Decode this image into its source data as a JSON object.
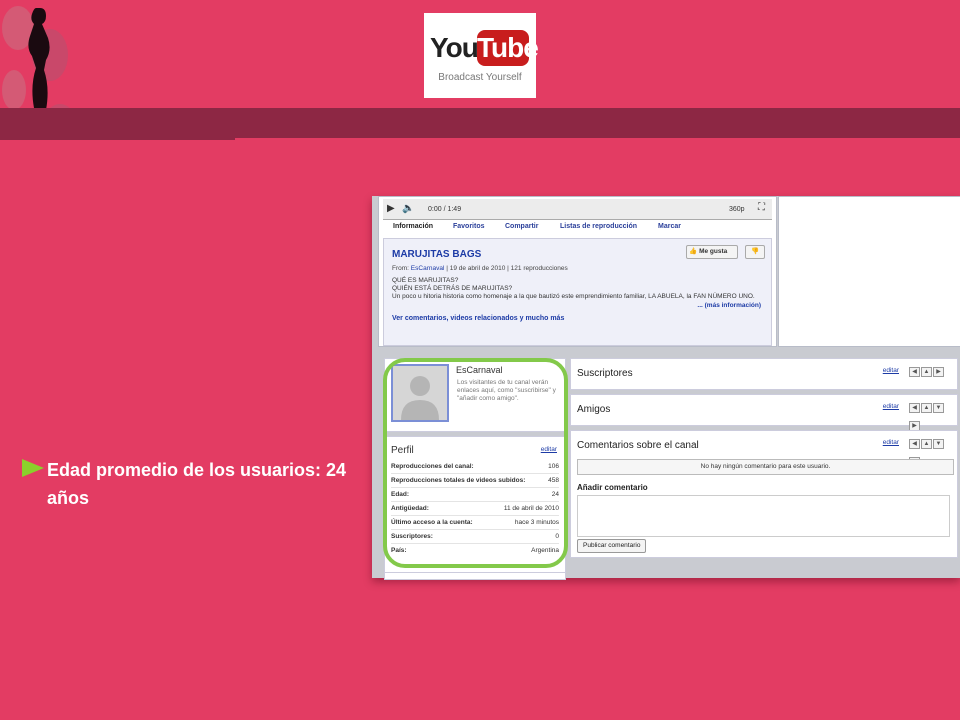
{
  "logo": {
    "you": "You",
    "tube": "Tube",
    "slogan": "Broadcast Yourself"
  },
  "bullet": {
    "text": "Edad promedio de los usuarios: 24 años"
  },
  "colors": {
    "background": "#e33c63",
    "band": "#8d2744",
    "accent": "#8bd12b",
    "ring": "#83c94a",
    "link": "#1d3ba6"
  },
  "player": {
    "time": "0:00 / 1:49",
    "quality": "360p"
  },
  "tabs": [
    {
      "label": "Información"
    },
    {
      "label": "Favoritos"
    },
    {
      "label": "Compartir"
    },
    {
      "label": "Listas de reproducción"
    },
    {
      "label": "Marcar"
    }
  ],
  "video": {
    "title": "MARUJITAS BAGS",
    "from_label": "From:",
    "author": "EsCarnaval",
    "meta_rest": "| 19 de abril de 2010 | 121 reproducciones",
    "desc1": "QUÉ ES MARUJITAS?",
    "desc2": "QUIÉN ESTÁ DETRÁS DE MARUJITAS?",
    "desc3": "Un poco u hitoria historia como homenaje a la que bautizó este emprendimiento familiar, LA ABUELA, la FAN NÚMERO UNO.",
    "more": "... (más información)",
    "related_link": "Ver comentarios, videos relacionados y mucho más",
    "like_label": "Me gusta"
  },
  "profile": {
    "name": "EsCarnaval",
    "note": "Los visitantes de tu canal verán enlaces aquí, como \"suscribirse\" y \"añadir como amigo\"."
  },
  "perfil": {
    "title": "Perfil",
    "edit": "editar",
    "rows": [
      {
        "k": "Reproducciones del canal:",
        "v": "106"
      },
      {
        "k": "Reproducciones totales de videos subidos:",
        "v": "458"
      },
      {
        "k": "Edad:",
        "v": "24"
      },
      {
        "k": "Antigüedad:",
        "v": "11 de abril de 2010"
      },
      {
        "k": "Último acceso a la cuenta:",
        "v": "hace 3 minutos"
      },
      {
        "k": "Suscriptores:",
        "v": "0"
      },
      {
        "k": "País:",
        "v": "Argentina"
      }
    ]
  },
  "sections": {
    "suscriptores": {
      "title": "Suscriptores",
      "edit": "editar"
    },
    "amigos": {
      "title": "Amigos",
      "edit": "editar"
    },
    "comentarios": {
      "title": "Comentarios sobre el canal",
      "edit": "editar",
      "notice": "No hay ningún comentario para este usuario.",
      "add_title": "Añadir comentario",
      "publish": "Publicar comentario"
    }
  }
}
